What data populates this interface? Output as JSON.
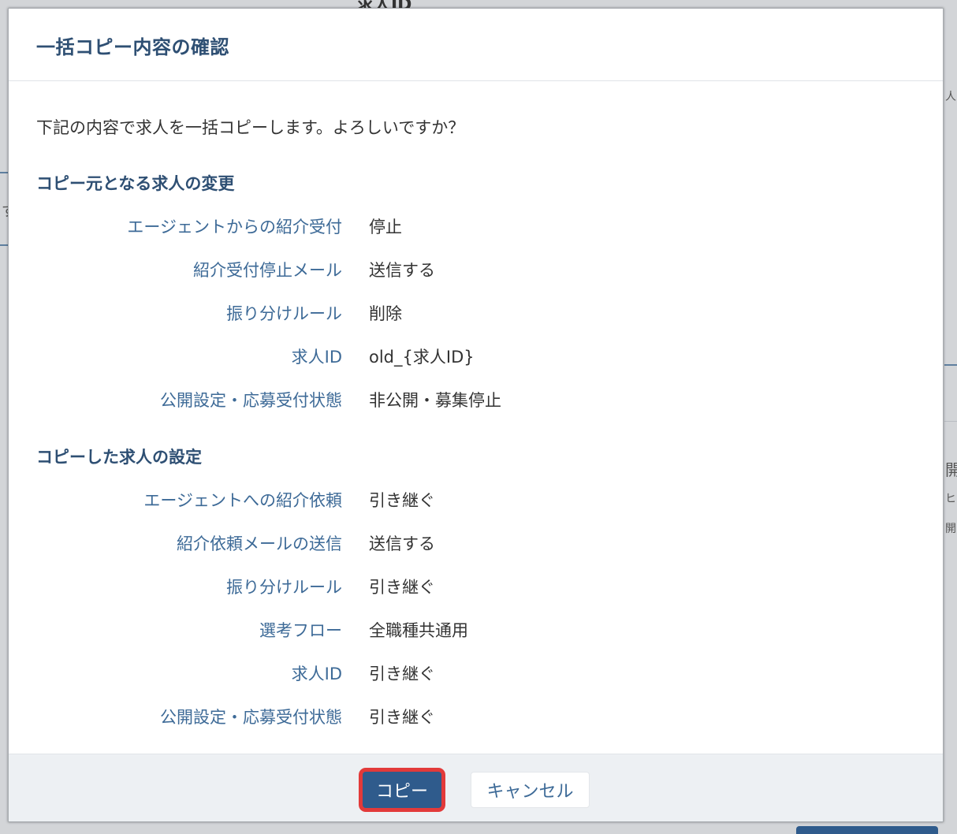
{
  "background": {
    "fragments": [
      "求人ID",
      "す",
      "人",
      "開",
      "ヒ",
      "開"
    ]
  },
  "modal": {
    "title": "一括コピー内容の確認",
    "lead": "下記の内容で求人を一括コピーします。よろしいですか？",
    "sections": [
      {
        "title": "コピー元となる求人の変更",
        "rows": [
          {
            "label": "エージェントからの紹介受付",
            "value": "停止"
          },
          {
            "label": "紹介受付停止メール",
            "value": "送信する"
          },
          {
            "label": "振り分けルール",
            "value": "削除"
          },
          {
            "label": "求人ID",
            "value": "old_{求人ID}"
          },
          {
            "label": "公開設定・応募受付状態",
            "value": "非公開・募集停止"
          }
        ]
      },
      {
        "title": "コピーした求人の設定",
        "rows": [
          {
            "label": "エージェントへの紹介依頼",
            "value": "引き継ぐ"
          },
          {
            "label": "紹介依頼メールの送信",
            "value": "送信する"
          },
          {
            "label": "振り分けルール",
            "value": "引き継ぐ"
          },
          {
            "label": "選考フロー",
            "value": "全職種共通用"
          },
          {
            "label": "求人ID",
            "value": "引き継ぐ"
          },
          {
            "label": "公開設定・応募受付状態",
            "value": "引き継ぐ"
          }
        ]
      }
    ],
    "footer": {
      "copy_label": "コピー",
      "cancel_label": "キャンセル"
    }
  },
  "colors": {
    "title": "#2e4f73",
    "label": "#3d6a97",
    "primary_button": "#2f5b8c",
    "highlight": "#e23a3a"
  }
}
